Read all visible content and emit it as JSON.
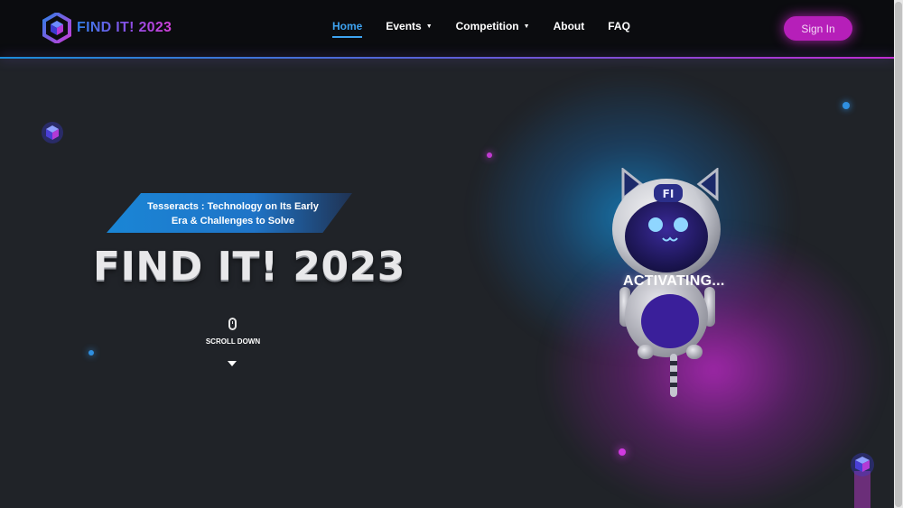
{
  "brand": {
    "logo_text": "FIND IT! 2023"
  },
  "nav": {
    "items": [
      {
        "label": "Home",
        "active": true,
        "dropdown": false
      },
      {
        "label": "Events",
        "active": false,
        "dropdown": true
      },
      {
        "label": "Competition",
        "active": false,
        "dropdown": true
      },
      {
        "label": "About",
        "active": false,
        "dropdown": false
      },
      {
        "label": "FAQ",
        "active": false,
        "dropdown": false
      }
    ],
    "signin_label": "Sign In"
  },
  "hero": {
    "tagline_line1": "Tesseracts : Technology on Its Early",
    "tagline_line2": "Era & Challenges to Solve",
    "title": "FIND IT! 2023",
    "scroll_label": "SCROLL DOWN"
  },
  "robot": {
    "status_text": "ACTIVATING...",
    "badge_text": "FI"
  },
  "colors": {
    "accent_blue": "#3ea3f0",
    "accent_purple": "#b61fb9",
    "background": "#202328",
    "navbar": "#0b0c0f"
  },
  "icons": [
    "logo-cube-icon",
    "caret-down-icon",
    "mouse-icon",
    "arrow-down-icon",
    "cube-particle-icon"
  ]
}
